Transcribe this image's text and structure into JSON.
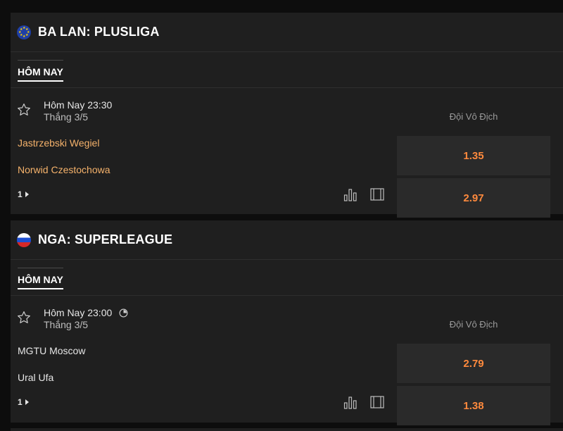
{
  "leagues": [
    {
      "title": "BA LAN: PLUSLIGA",
      "flag": "eu-flag-icon",
      "day_tab": "HÔM NAY",
      "match": {
        "time": "Hôm Nay 23:30",
        "date": "Thắng 3/5",
        "team1": "Jastrzebski Wegiel",
        "team2": "Norwid Czestochowa",
        "team_color": "#f5b26b",
        "more_count": "1",
        "market": "Đội Vô Địch",
        "odd1": "1.35",
        "odd2": "2.97",
        "has_clock": false
      }
    },
    {
      "title": "NGA: SUPERLEAGUE",
      "flag": "russia-flag-icon",
      "day_tab": "HÔM NAY",
      "match": {
        "time": "Hôm Nay 23:00",
        "date": "Thắng 3/5",
        "team1": "MGTU Moscow",
        "team2": "Ural Ufa",
        "team_color": "#e6e6e6",
        "more_count": "1",
        "market": "Đội Vô Địch",
        "odd1": "2.79",
        "odd2": "1.38",
        "has_clock": true
      }
    }
  ],
  "colors": {
    "background": "#0d0d0d",
    "panel": "#1f1f1f",
    "odd_box": "#2a2a2a",
    "odd_text": "#ff8a3d"
  }
}
